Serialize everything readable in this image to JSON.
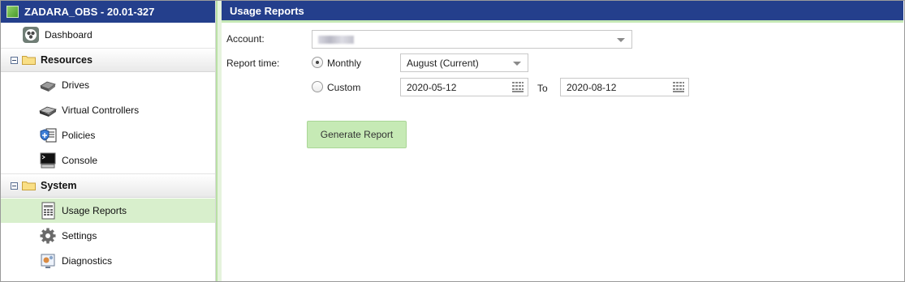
{
  "app": {
    "title": "ZADARA_OBS - 20.01-327"
  },
  "sidebar": {
    "dashboard": "Dashboard",
    "resources": {
      "label": "Resources",
      "items": [
        "Drives",
        "Virtual Controllers",
        "Policies",
        "Console"
      ]
    },
    "system": {
      "label": "System",
      "items": [
        "Usage Reports",
        "Settings",
        "Diagnostics"
      ]
    },
    "selected": "Usage Reports"
  },
  "main": {
    "title": "Usage Reports",
    "account_label": "Account:",
    "report_time_label": "Report time:",
    "monthly_label": "Monthly",
    "custom_label": "Custom",
    "month_select_value": "August (Current)",
    "start_date": "2020-05-12",
    "to_label": "To",
    "end_date": "2020-08-12",
    "generate_button": "Generate Report",
    "report_mode": "monthly"
  },
  "colors": {
    "header_bg": "#243f8c",
    "selected_bg": "#d8efcc",
    "button_bg": "#c6eab5"
  }
}
